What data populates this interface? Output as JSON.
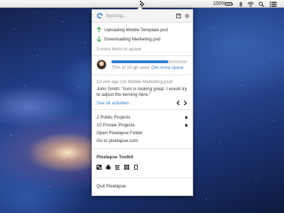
{
  "menubar": {
    "battery_pct": "100%",
    "battery_level": 1.0,
    "icons": [
      "pixelapse-icon",
      "bluetooth-icon",
      "wifi-icon",
      "search-icon",
      "list-icon"
    ]
  },
  "header": {
    "status": "Syncing..."
  },
  "transfers": {
    "items": [
      {
        "label": "Uploading Mobile Template.psd",
        "icon": "upload-arrow-icon",
        "color": "#3aa845"
      },
      {
        "label": "Downloading Marketing.psd",
        "icon": "download-arrow-icon",
        "color": "#3aa845"
      }
    ],
    "queue_text": "3 more items in queue"
  },
  "storage": {
    "used_fraction": 0.75,
    "used_text": "75% of 20 gb used",
    "more_link": "Get more space",
    "bar_color": "#2f7fd1"
  },
  "activity": {
    "meta": "10 min ago (on Mobile Marketing.psd)",
    "comment": "John Smith: \"Icon is looking great. I would try to adjust the kerning here.\"",
    "see_all": "See all activities"
  },
  "projects": {
    "items": [
      {
        "label": "2 Public Projects",
        "has_submenu": true
      },
      {
        "label": "10 Private Projects",
        "has_submenu": true
      },
      {
        "label": "Open Pixelapse Folder",
        "has_submenu": false
      },
      {
        "label": "Go to pixelapse.com",
        "has_submenu": false
      }
    ]
  },
  "toolkit": {
    "title": "Pixelapse Toolkit",
    "tools": [
      "color-swatch-icon",
      "layers-icon",
      "crop-icon",
      "grid-icon",
      "device-icon"
    ]
  },
  "footer": {
    "quit": "Quit Pixelapse"
  }
}
